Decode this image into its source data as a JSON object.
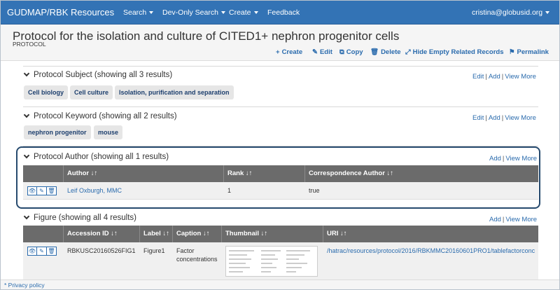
{
  "navbar": {
    "brand": "GUDMAP/RBK Resources",
    "items": [
      "Search",
      "Dev-Only Search",
      "Create",
      "Feedback"
    ],
    "user": "cristina@globusid.org"
  },
  "title": {
    "heading": "Protocol for the isolation and culture of CITED1+ nephron progenitor cells",
    "subtitle": "PROTOCOL"
  },
  "actions": [
    {
      "icon": "+",
      "label": "Create"
    },
    {
      "icon": "✎",
      "label": "Edit"
    },
    {
      "icon": "⧉",
      "label": "Copy"
    },
    {
      "icon": "🗑",
      "label": "Delete"
    },
    {
      "icon": "⤢",
      "label": "Hide Empty Related Records"
    },
    {
      "icon": "⚑",
      "label": "Permalink"
    }
  ],
  "subject": {
    "heading": "Protocol Subject (showing all 3 results)",
    "links": [
      "Edit",
      "Add",
      "View More"
    ],
    "chips": [
      "Cell biology",
      "Cell culture",
      "Isolation, purification and separation"
    ]
  },
  "keyword": {
    "heading": "Protocol Keyword (showing all 2 results)",
    "links": [
      "Edit",
      "Add",
      "View More"
    ],
    "chips": [
      "nephron progenitor",
      "mouse"
    ]
  },
  "author": {
    "heading": "Protocol Author (showing all 1 results)",
    "links": [
      "Add",
      "View More"
    ],
    "columns": [
      "Author ↓↑",
      "Rank ↓↑",
      "Correspondence Author ↓↑"
    ],
    "rows": [
      {
        "author": "Leif Oxburgh, MMC",
        "rank": "1",
        "correspondence": "true"
      }
    ]
  },
  "figure": {
    "heading": "Figure (showing all 4 results)",
    "links": [
      "Add",
      "View More"
    ],
    "columns": [
      "Accession ID ↓↑",
      "Label ↓↑",
      "Caption ↓↑",
      "Thumbnail ↓↑",
      "URI ↓↑"
    ],
    "rows": [
      {
        "accession": "RBKUSC20160526FIG1",
        "label": "Figure1",
        "caption_line1": "Factor",
        "caption_line2": "concentrations",
        "uri": "/hatrac/resources/protocol/2016/RBKMMC20160601PRO1/tablefactorconc"
      }
    ]
  },
  "row_buttons": {
    "view": "👁",
    "edit": "✎",
    "delete": "🗑"
  },
  "footer": {
    "privacy": "* Privacy policy"
  },
  "colors": {
    "navbar": "#3373b5",
    "link": "#2a6bad",
    "table_header": "#6b6b6b",
    "highlight": "#264a6e"
  }
}
